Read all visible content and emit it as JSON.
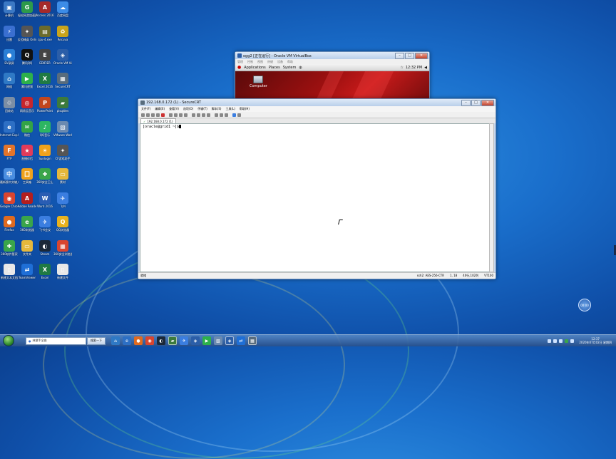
{
  "desktop_icons": [
    {
      "label": "计算机",
      "color": "#3b78c4",
      "glyph": "▣"
    },
    {
      "label": "轻松网游加速器",
      "color": "#2d9a4a",
      "glyph": "G"
    },
    {
      "label": "Access 2016",
      "color": "#a52a2a",
      "glyph": "A"
    },
    {
      "label": "百度网盘",
      "color": "#3c8ce7",
      "glyph": "☁"
    },
    {
      "label": "迅雷",
      "color": "#3a6fd0",
      "glyph": "⚡"
    },
    {
      "label": "反恐精英 Online",
      "color": "#555555",
      "glyph": "✦"
    },
    {
      "label": "cpu-4.exe",
      "color": "#6b6b2b",
      "glyph": "▤"
    },
    {
      "label": "Recuva",
      "color": "#c9a41b",
      "glyph": "♻"
    },
    {
      "label": "EV录屏",
      "color": "#2a7fd6",
      "glyph": "●"
    },
    {
      "label": "腾讯QQ",
      "color": "#111111",
      "glyph": "Q"
    },
    {
      "label": "EDIFIER",
      "color": "#444444",
      "glyph": "E"
    },
    {
      "label": "Oracle VM VirtualBox",
      "color": "#2b5ea8",
      "glyph": "◈"
    },
    {
      "label": "网络",
      "color": "#2f79c5",
      "glyph": "⌂"
    },
    {
      "label": "腾讯视频",
      "color": "#2db14a",
      "glyph": "▶"
    },
    {
      "label": "Excel 2016",
      "color": "#1f7a43",
      "glyph": "X"
    },
    {
      "label": "SecureCRT",
      "color": "#586c7d",
      "glyph": "▦"
    },
    {
      "label": "回收站",
      "color": "#7b8ea5",
      "glyph": "♲"
    },
    {
      "label": "网易云音乐",
      "color": "#c7252c",
      "glyph": "◎"
    },
    {
      "label": "PowerPoint",
      "color": "#c2461d",
      "glyph": "P"
    },
    {
      "label": "plsqldev",
      "color": "#3c7a3c",
      "glyph": "▰"
    },
    {
      "label": "Internet Explorer",
      "color": "#2d6fc4",
      "glyph": "e"
    },
    {
      "label": "微信",
      "color": "#33a345",
      "glyph": "✉"
    },
    {
      "label": "QQ音乐",
      "color": "#2db562",
      "glyph": "♪"
    },
    {
      "label": "VMware Workstation",
      "color": "#6b8ab0",
      "glyph": "▧"
    },
    {
      "label": "FTP",
      "color": "#e3742a",
      "glyph": "F"
    },
    {
      "label": "直播伴侣",
      "color": "#e23b5a",
      "glyph": "★"
    },
    {
      "label": "Sunlogin",
      "color": "#f0a21b",
      "glyph": "☀"
    },
    {
      "label": "CF游戏助手",
      "color": "#555555",
      "glyph": "✦"
    },
    {
      "label": "最新版中文输入",
      "color": "#4a8ee0",
      "glyph": "中"
    },
    {
      "label": "工具箱",
      "color": "#f0a21b",
      "glyph": "囗"
    },
    {
      "label": "360安全卫士",
      "color": "#3aa54a",
      "glyph": "✚"
    },
    {
      "label": "素材",
      "color": "#e6b83c",
      "glyph": "▭"
    },
    {
      "label": "Google Chrome",
      "color": "#d9452f",
      "glyph": "◉"
    },
    {
      "label": "Adobe Reader",
      "color": "#b31e1e",
      "glyph": "A"
    },
    {
      "label": "Word 2016",
      "color": "#2a5db3",
      "glyph": "W"
    },
    {
      "label": "飞书",
      "color": "#3b7ee0",
      "glyph": "✈"
    },
    {
      "label": "Firefox",
      "color": "#e06a1f",
      "glyph": "●"
    },
    {
      "label": "360浏览器",
      "color": "#3aa54a",
      "glyph": "e"
    },
    {
      "label": "飞书会议",
      "color": "#3b7ee0",
      "glyph": "✈"
    },
    {
      "label": "QQ浏览器",
      "color": "#e9b21d",
      "glyph": "Q"
    },
    {
      "label": "360软件管家",
      "color": "#3aa54a",
      "glyph": "✚"
    },
    {
      "label": "文件夹",
      "color": "#e6b83c",
      "glyph": "▭"
    },
    {
      "label": "Steam",
      "color": "#1b2838",
      "glyph": "◐"
    },
    {
      "label": "360安全浏览器",
      "color": "#d9452f",
      "glyph": "▦"
    },
    {
      "label": "新建文本文档",
      "color": "#e8e8e8",
      "glyph": "▯"
    },
    {
      "label": "TeamViewer",
      "color": "#1f6fd6",
      "glyph": "⇄"
    },
    {
      "label": "Excel",
      "color": "#1f7a43",
      "glyph": "X"
    },
    {
      "label": "新建文件",
      "color": "#e8e8e8",
      "glyph": "▯"
    }
  ],
  "vbox": {
    "title": "ogg2 [正在运行] - Oracle VM VirtualBox",
    "menu": [
      "管理",
      "控制",
      "视图",
      "热键",
      "设备",
      "帮助"
    ],
    "panel_menus": [
      "Applications",
      "Places",
      "System"
    ],
    "clock": "12:32 PM",
    "desktop_icon_label": "Computer"
  },
  "scrt": {
    "title": "192.168.0.172 (1) - SecureCRT",
    "menu": [
      "文件(F)",
      "编辑(E)",
      "查看(V)",
      "选项(O)",
      "传输(T)",
      "脚本(S)",
      "工具(L)",
      "帮助(H)"
    ],
    "tab_label": "192.168.0.172 (1)",
    "terminal_line": "[oracle@grid1 ~]$",
    "status_left": "就绪",
    "status_cipher": "ssh2: AES-256-CTR",
    "status_pos": "1, 18",
    "status_size": "40行,102列",
    "status_term": "VT100"
  },
  "taskbar": {
    "search_text": "林黛手全曲",
    "search_button": "搜索一下",
    "clock_time": "12:37",
    "clock_date": "2020年07月02日 星期四"
  },
  "float_button_label": "00:00"
}
